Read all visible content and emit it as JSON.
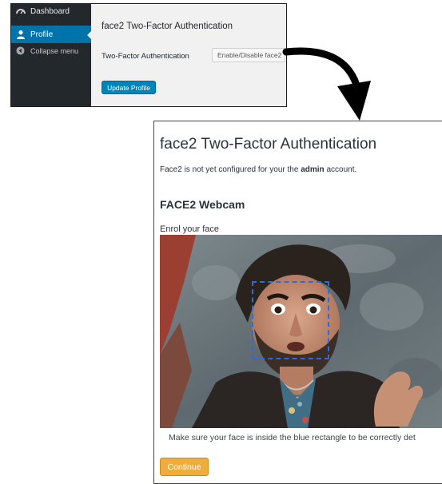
{
  "sidebar": {
    "items": [
      {
        "label": "Dashboard",
        "icon": "dashboard-icon"
      },
      {
        "label": "Profile",
        "icon": "user-icon",
        "active": true
      },
      {
        "label": "Collapse menu",
        "icon": "collapse-icon"
      }
    ],
    "background": "#23282d",
    "active_color": "#0073aa"
  },
  "profile_form": {
    "section_title": "face2 Two-Factor Authentication",
    "field_label": "Two-Factor Authentication",
    "toggle_label": "Enable/Disable face2",
    "update_button": "Update Profile",
    "button_color": "#0085ba"
  },
  "enrolment": {
    "title": "face2 Two-Factor Authentication",
    "notice_prefix": "Face2 is not yet configured for your the ",
    "notice_user": "admin",
    "notice_suffix": " account.",
    "webcam_title": "FACE2 Webcam",
    "enrol_label": "Enrol your face",
    "hint": "Make sure your face is inside the blue rectangle to be correctly det",
    "continue_button": "Continue",
    "continue_color": "#f0ad3e",
    "rectangle_color": "#2f6bd8"
  }
}
